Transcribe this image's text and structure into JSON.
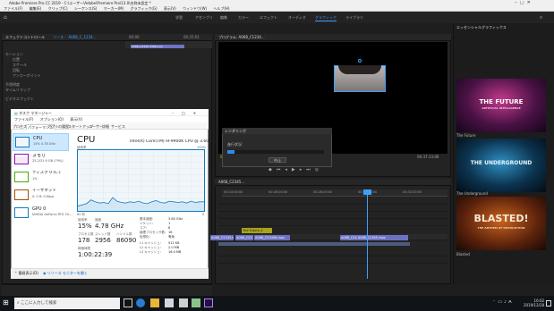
{
  "premiere": {
    "title": "Adobe Premiere Pro CC 2019 - C:\\ユーザー\\Adobe\\Premiere Pro\\13.0\\名称未設定 *",
    "menu": [
      "ファイル(F)",
      "編集(E)",
      "クリップ(C)",
      "シーケンス(S)",
      "マーカー(M)",
      "グラフィック(G)",
      "表示(V)",
      "ウィンドウ(W)",
      "ヘルプ(H)"
    ],
    "workspaces": [
      "学習",
      "アセンブリ",
      "編集",
      "カラー",
      "エフェクト",
      "オーディオ",
      "グラフィック",
      "ライブラリ"
    ],
    "active_workspace": "グラフィック",
    "effect_controls": {
      "tab": "エフェクトコントロール",
      "clip_label": "ソース・ A068_C_1234...",
      "rows": [
        "モーション",
        "位置",
        "スケール",
        "回転",
        "アンカーポイント",
        "不透明度",
        "タイムリマップ",
        "ビデオエフェクト"
      ],
      "time_a": "00:00",
      "time_b": "00:25:01",
      "clip": "A068_C2345 3386 mov"
    },
    "program": {
      "tab": "プログラム: A068_C1234...",
      "timecode": "00:00:19:19",
      "duration": "00:37:13:06"
    },
    "timeline": {
      "tab": "A068_C2345...",
      "ruler": [
        "00:24:00:00",
        "00:26:00:00",
        "00:28:00:00",
        "00:30:00:00",
        "00:32:00:00"
      ],
      "title_clip": "The Future_2",
      "clips": [
        "A068_C2345.mov",
        "A068_C23...",
        "A068_C23456.mov",
        "A068_C24 A068_C2345 mov"
      ]
    },
    "graphics": {
      "tab": "エッセンシャルグラフィックス",
      "templates": [
        {
          "title": "THE FUTURE",
          "sub": "ARTIFICIAL INTELLIGENCE",
          "name": "The Future"
        },
        {
          "title": "THE UNDERGROUND",
          "sub": "",
          "name": "The Underground"
        },
        {
          "title": "BLASTED!",
          "sub": "THE ANTHEM OF DESTRUCTION",
          "name": "Blasted"
        }
      ]
    },
    "render": {
      "title": "レンダリング",
      "label": "進行状況:",
      "progress": 0.07,
      "cancel": "中止"
    }
  },
  "taskmgr": {
    "title": "タスク マネージャー",
    "menu": [
      "ファイル(F)",
      "オプション(O)",
      "表示(V)"
    ],
    "tabs": [
      "プロセス",
      "パフォーマンス",
      "アプリの履歴",
      "スタートアップ",
      "ユーザー",
      "詳細",
      "サービス"
    ],
    "active_tab": "パフォーマンス",
    "devices": [
      {
        "name": "CPU",
        "sub": "15% 4.78 GHz",
        "color": "#117dbb"
      },
      {
        "name": "メモリ",
        "sub": "25.2/31.9 GB (79%)",
        "color": "#8b12ae"
      },
      {
        "name": "ディスク 0 (C:)",
        "sub": "1%",
        "color": "#4da60c"
      },
      {
        "name": "イーサネット",
        "sub": "S: 0 R: 0 Kbps",
        "color": "#a74f01"
      },
      {
        "name": "GPU 0",
        "sub": "NVIDIA GeForce RTX 20...",
        "color": "#117dbb"
      }
    ],
    "cpu_title": "CPU",
    "cpu_model": "Intel(R) Core(TM) i9-9900K CPU @ 3.60GHz",
    "graph_label": "使用率",
    "graph_max": "100%",
    "graph_time": "60 秒",
    "graph_min": "0",
    "usage_label": "使用率",
    "usage": "15%",
    "speed_label": "速度",
    "speed": "4.78 GHz",
    "proc_label": "プロセス数",
    "proc": "178",
    "thread_label": "スレッド数",
    "thread": "2956",
    "handle_label": "ハンドル数",
    "handle": "86090",
    "uptime_label": "稼働時間",
    "uptime": "1:00:22:39",
    "specs": [
      [
        "基本速度:",
        "3.60 GHz"
      ],
      [
        "ソケット:",
        "1"
      ],
      [
        "コア:",
        "8"
      ],
      [
        "論理プロセッサ数:",
        "16"
      ],
      [
        "仮想化:",
        "有効"
      ],
      [
        "L1 キャッシュ:",
        "512 KB"
      ],
      [
        "L2 キャッシュ:",
        "2.0 MB"
      ],
      [
        "L3 キャッシュ:",
        "16.0 MB"
      ]
    ],
    "footer_less": "簡易表示(D)",
    "footer_link": "リソース モニターを開く",
    "graph_series": [
      0.08,
      0.1,
      0.12,
      0.18,
      0.15,
      0.13,
      0.14,
      0.12,
      0.22,
      0.16,
      0.14,
      0.13,
      0.15,
      0.14,
      0.16,
      0.13,
      0.12,
      0.15,
      0.17,
      0.14,
      0.13,
      0.16,
      0.15,
      0.14,
      0.15,
      0.13,
      0.16,
      0.14,
      0.15,
      0.15
    ]
  },
  "taskbar": {
    "search_placeholder": "ここに入力して検索",
    "time": "16:02",
    "date": "2019/12/28"
  }
}
